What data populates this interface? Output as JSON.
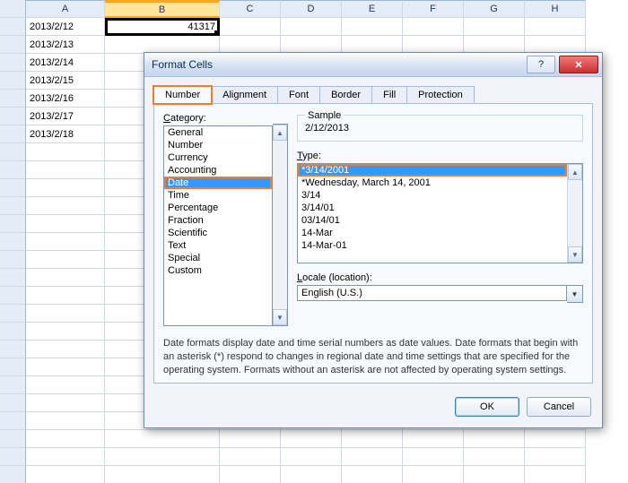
{
  "columns": [
    "A",
    "B",
    "C",
    "D",
    "E",
    "F",
    "G",
    "H"
  ],
  "cellA": [
    "2013/2/12",
    "2013/2/13",
    "2013/2/14",
    "2013/2/15",
    "2013/2/16",
    "2013/2/17",
    "2013/2/18"
  ],
  "cellB1": "41317",
  "dialog": {
    "title": "Format Cells",
    "help_glyph": "?",
    "close_glyph": "✕",
    "tabs": [
      "Number",
      "Alignment",
      "Font",
      "Border",
      "Fill",
      "Protection"
    ],
    "category_label": "Category:",
    "categories": [
      "General",
      "Number",
      "Currency",
      "Accounting",
      "Date",
      "Time",
      "Percentage",
      "Fraction",
      "Scientific",
      "Text",
      "Special",
      "Custom"
    ],
    "selected_category_index": 4,
    "sample_label": "Sample",
    "sample_value": "2/12/2013",
    "type_label": "Type:",
    "types": [
      "*3/14/2001",
      "*Wednesday, March 14, 2001",
      "3/14",
      "3/14/01",
      "03/14/01",
      "14-Mar",
      "14-Mar-01"
    ],
    "selected_type_index": 0,
    "locale_label": "Locale (location):",
    "locale_value": "English (U.S.)",
    "description": "Date formats display date and time serial numbers as date values.  Date formats that begin with an asterisk (*) respond to changes in regional date and time settings that are specified for the operating system. Formats without an asterisk are not affected by operating system settings.",
    "ok": "OK",
    "cancel": "Cancel"
  }
}
